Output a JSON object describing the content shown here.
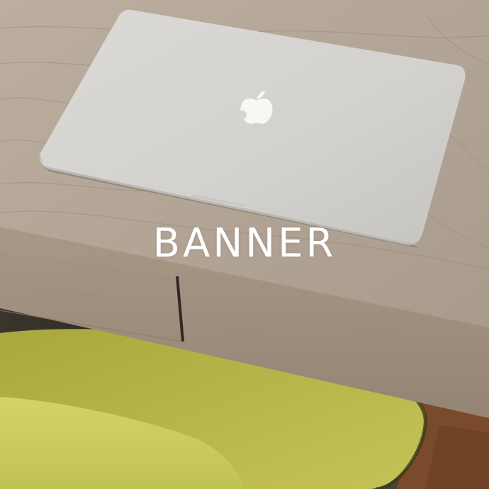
{
  "banner": {
    "title": "BANNER"
  },
  "image": {
    "subject": "laptop-on-wooden-desk",
    "icons": [
      "apple-logo-icon"
    ]
  },
  "colors": {
    "wood_light": "#b8aa9b",
    "wood_mid": "#a39383",
    "wood_dark": "#8d7d6d",
    "laptop": "#d8d6d3",
    "chair": "#b8b84a",
    "floor": "#7a4a2c",
    "shadow": "#3a342e",
    "title": "#ffffff"
  }
}
